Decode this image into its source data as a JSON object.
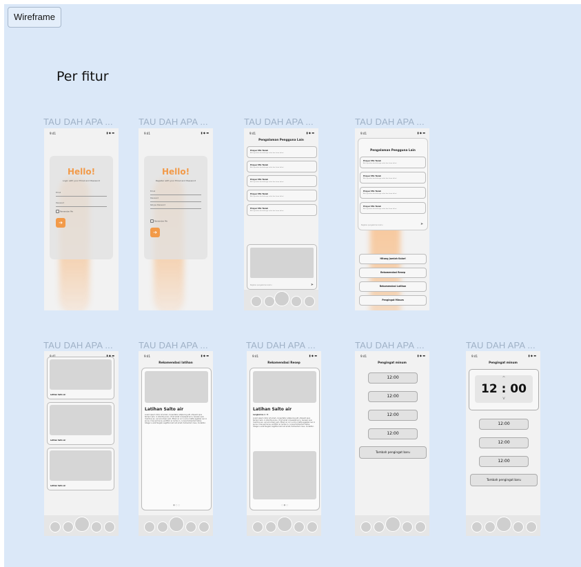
{
  "toolbar": {
    "button_label": "Wireframe"
  },
  "section": {
    "title": "Per fitur"
  },
  "frames": {
    "label": "TAU DAH APA ..."
  },
  "status": {
    "time": "9:41",
    "icons": "▮ ◆ ▬"
  },
  "login": {
    "hello": "Hello!",
    "login_sub": "Login with your Email and Password",
    "register_sub": "Register with your Email and Password",
    "email": "Email",
    "password": "Password",
    "retype": "Retype Password",
    "remember": "Remember Me",
    "arrow": "➔"
  },
  "community": {
    "title": "Pengalaman Pengguna Lain",
    "name": "Prayer MG Tarak",
    "stamp": "· 1 hrs ago",
    "desc": "Aktif gerakan berolahraga sehat dan lama kalori",
    "input_placeholder": "Bagikan pengalaman kamu",
    "send": "➤"
  },
  "menu": {
    "items": [
      "Hitung Jumlah Kalori",
      "Rekomendasi Resep",
      "Rekomendasi Latihan",
      "Pengingat Minum"
    ]
  },
  "latihan": {
    "list_caption": "Latihan Salto air",
    "title": "Rekomendasi latihan",
    "heading": "Latihan Salto air",
    "body": "Lorem ipsum dolor sit amet, consectetur adipiscing elit. Aliquam quis tempor sem, in lobortis purus. Ut sit amet consequat arcu. Aenean quis maximus ex, vel accumsan sem. Etiam ac orci a arcu mattis egestas nec in purus. Cras sed lacus, porttitor ac lectus in, cursus fermentum tellus. Integer a erat feugiat, sagittis lorem sit amet, fermentum risus. Curabitur.",
    "dots": "● ○ ○"
  },
  "resep": {
    "title": "Rekomendasi Resep",
    "heading": "Latihan Salto air",
    "sub": "Langkah ke 1 : 5",
    "body": "Lorem ipsum dolor sit amet, consectetur adipiscing elit. Aliquam quis tempor sem, in lobortis purus. Ut sit amet consequat arcu. Aenean quis maximus ex, vel accumsan sem. Etiam ac orci a arcu mattis egestas nec in purus. Cras sed lacus, porttitor ac lectus in, cursus fermentum tellus. Integer a erat feugiat, sagittis lorem sit amet, fermentum risus. Curabitur.",
    "dots": "○ ● ○"
  },
  "reminder": {
    "title": "Pengingat minum",
    "time": "12:00",
    "big_time": "12 : 00",
    "up": "^",
    "down": "v",
    "add": "Tambah pengingat baru"
  }
}
